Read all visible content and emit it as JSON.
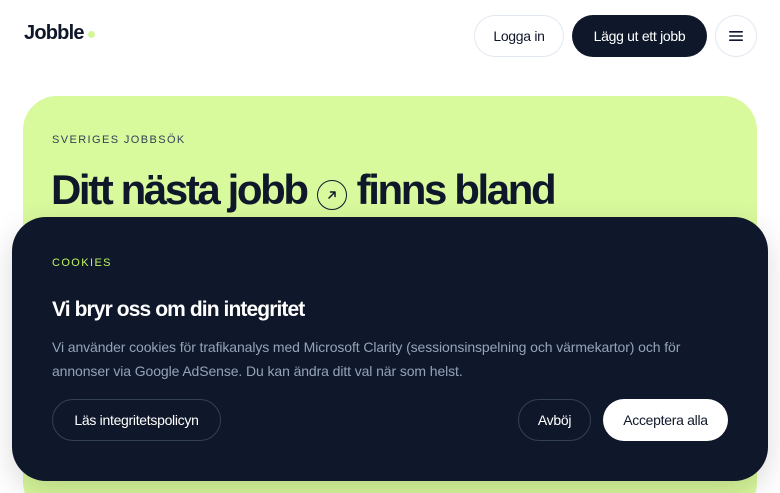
{
  "header": {
    "logo_text": "Jobble",
    "login_label": "Logga in",
    "post_job_label": "Lägg ut ett jobb",
    "menu_icon": "hamburger-menu-icon"
  },
  "hero": {
    "eyebrow": "SVERIGES JOBBSÖK",
    "headline_part1": "Ditt nästa jobb",
    "headline_icon": "arrow-up-right-icon",
    "headline_part2": "finns bland"
  },
  "cookie_banner": {
    "label": "COOKIES",
    "title": "Vi bryr oss om din integritet",
    "text": "Vi använder cookies för trafikanalys med Microsoft Clarity (sessionsinspelning och värmekartor) och för annonser via Google AdSense. Du kan ändra ditt val när som helst.",
    "policy_label": "Läs integritetspolicyn",
    "decline_label": "Avböj",
    "accept_label": "Acceptera alla"
  },
  "colors": {
    "accent_lime": "#d9f99d",
    "dark_navy": "#0f172a",
    "cookie_label_lime": "#bef264"
  }
}
